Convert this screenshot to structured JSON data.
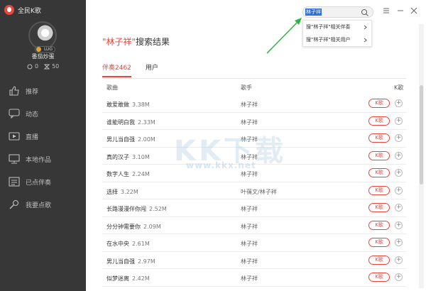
{
  "app": {
    "name": "全民K歌"
  },
  "user": {
    "name": "番茄炒蛋",
    "level": "LUG",
    "stat_a": "0",
    "stat_b": "50"
  },
  "nav": [
    {
      "label": "推荐",
      "icon": "thumb-up-icon"
    },
    {
      "label": "动态",
      "icon": "chat-icon"
    },
    {
      "label": "直播",
      "icon": "video-icon"
    },
    {
      "label": "本地作品",
      "icon": "monitor-icon"
    },
    {
      "label": "已点伴奏",
      "icon": "list-icon"
    },
    {
      "label": "我要点歌",
      "icon": "mic-icon"
    }
  ],
  "search": {
    "value": "林子祥",
    "suggestions": [
      {
        "label": "搜\"林子祥\"相关伴奏"
      },
      {
        "label": "搜\"林子祥\"相关用户"
      }
    ]
  },
  "result": {
    "keyword": "\"林子祥\"",
    "suffix": "搜索结果"
  },
  "tabs": [
    {
      "label": "伴奏2462"
    },
    {
      "label": "用户"
    }
  ],
  "table": {
    "headers": {
      "song": "歌曲",
      "singer": "歌手",
      "k": "K歌"
    },
    "k_label": "K歌",
    "rows": [
      {
        "song": "敢爱敢做",
        "size": "3.38M",
        "singer": "林子祥"
      },
      {
        "song": "谁能明白我",
        "size": "2.33M",
        "singer": "林子祥"
      },
      {
        "song": "男儿当自强",
        "size": "2.00M",
        "singer": "林子祥"
      },
      {
        "song": "真的汉子",
        "size": "3.10M",
        "singer": "林子祥"
      },
      {
        "song": "数字人生",
        "size": "2.24M",
        "singer": "林子祥"
      },
      {
        "song": "选择",
        "size": "3.22M",
        "singer": "叶蒨文/林子祥"
      },
      {
        "song": "长路漫漫伴你闯",
        "size": "2.52M",
        "singer": "林子祥"
      },
      {
        "song": "分分钟需要你",
        "size": "2.09M",
        "singer": "林子祥"
      },
      {
        "song": "在水中央",
        "size": "2.61M",
        "singer": "林子祥"
      },
      {
        "song": "男儿当自强",
        "size": "2.97M",
        "singer": "林子祥"
      },
      {
        "song": "似梦迷离",
        "size": "2.42M",
        "singer": "林子祥"
      }
    ]
  },
  "watermark": {
    "text": "KK下载",
    "url": "www.kkx.net"
  },
  "colors": {
    "accent": "#e8453c",
    "sidebar": "#373737",
    "arrow": "#2fb344"
  }
}
